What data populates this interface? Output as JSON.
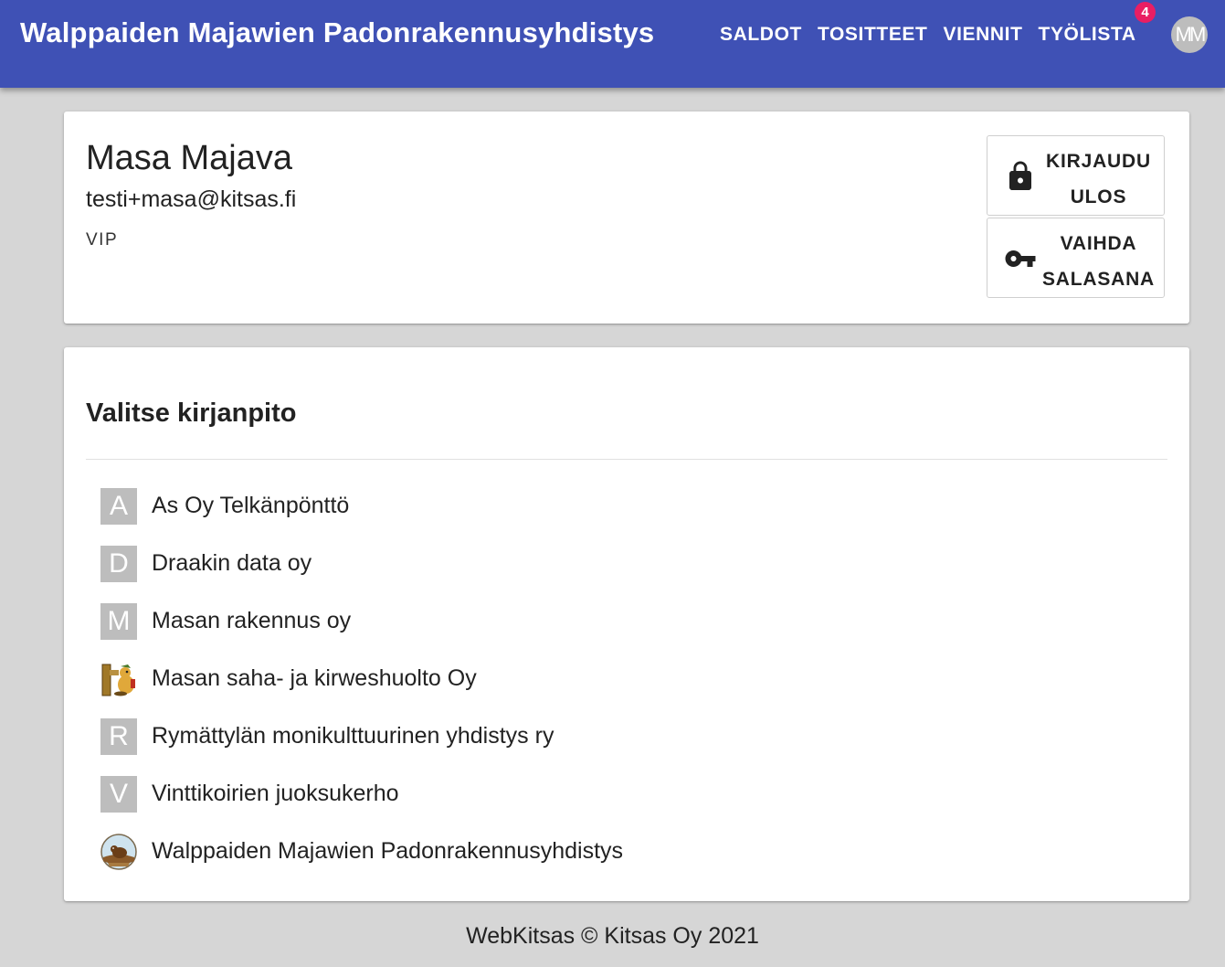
{
  "header": {
    "title": "Walppaiden Majawien Padonrakennusyhdistys",
    "nav": [
      "SALDOT",
      "TOSITTEET",
      "VIENNIT",
      "TYÖLISTA"
    ],
    "badge_count": "4",
    "avatar_initials": "MM",
    "color": "#3f51b5"
  },
  "user": {
    "name": "Masa Majava",
    "email": "testi+masa@kitsas.fi",
    "role": "VIP",
    "logout_label": "KIRJAUDU ULOS",
    "logout_icon": "lock-icon",
    "change_password_label": "VAIHDA SALASANA",
    "change_password_icon": "key-icon"
  },
  "books": {
    "title": "Valitse kirjanpito",
    "items": [
      {
        "initial": "A",
        "name": "As Oy Telkänpönttö",
        "icon": "letter"
      },
      {
        "initial": "D",
        "name": "Draakin data oy",
        "icon": "letter"
      },
      {
        "initial": "M",
        "name": "Masan rakennus oy",
        "icon": "letter"
      },
      {
        "initial": "",
        "name": "Masan saha- ja kirweshuolto Oy",
        "icon": "beaver-logo-icon"
      },
      {
        "initial": "R",
        "name": "Rymättylän monikulttuurinen yhdistys ry",
        "icon": "letter"
      },
      {
        "initial": "V",
        "name": "Vinttikoirien juoksukerho",
        "icon": "letter"
      },
      {
        "initial": "",
        "name": "Walppaiden Majawien Padonrakennusyhdistys",
        "icon": "round-beaver-logo-icon"
      }
    ]
  },
  "footer": {
    "text": "WebKitsas © Kitsas Oy 2021"
  }
}
